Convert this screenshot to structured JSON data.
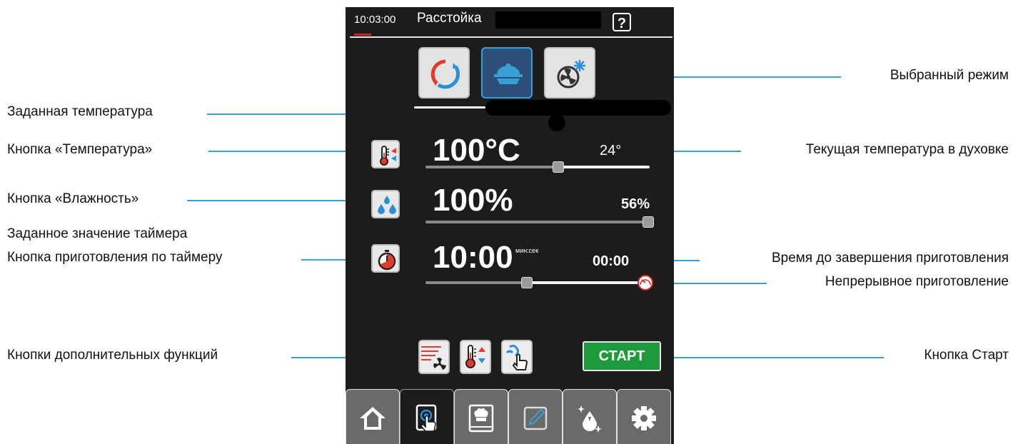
{
  "header": {
    "time": "10:03:00",
    "title": "Расстойка",
    "help_label": "?"
  },
  "modes": [
    {
      "name": "combi-steam",
      "icon": "circular-arrows-icon",
      "selected": false
    },
    {
      "name": "proofing",
      "icon": "covered-dish-icon",
      "selected": true
    },
    {
      "name": "fan-cooling",
      "icon": "fan-snowflake-icon",
      "selected": false
    }
  ],
  "settings": {
    "temperature": {
      "set_value": "100°C",
      "current": "24°",
      "slider_fraction": 0.6
    },
    "humidity": {
      "set_value": "100%",
      "current": "56%",
      "slider_fraction": 1.0
    },
    "timer": {
      "set_value": "10:00",
      "unit": "мин:сек",
      "remaining": "00:00",
      "slider_fraction": 0.45
    }
  },
  "bottom_actions": {
    "start_label": "СТАРТ"
  },
  "tabs": [
    {
      "icon": "home-icon",
      "active": false
    },
    {
      "icon": "touch-screen-icon",
      "active": true
    },
    {
      "icon": "cookbook-icon",
      "active": false
    },
    {
      "icon": "edit-icon",
      "active": false
    },
    {
      "icon": "cleaning-drops-icon",
      "active": false
    },
    {
      "icon": "gear-icon",
      "active": false
    }
  ],
  "callouts": {
    "selected_mode": "Выбранный режим",
    "set_temperature": "Заданная температура",
    "temperature_button": "Кнопка «Температура»",
    "current_oven_temperature": "Текущая температура в духовке",
    "humidity_button": "Кнопка «Влажность»",
    "set_timer_value": "Заданное значение таймера",
    "timer_cooking_button": "Кнопка приготовления по таймеру",
    "time_until_done": "Время до завершения приготовления",
    "continuous_cooking": "Непрерывное приготовление",
    "extra_functions_buttons": "Кнопки дополнительных функций",
    "start_button": "Кнопка Старт"
  },
  "colors": {
    "accent": "#3a9fd4",
    "start_green": "#1e9a3c",
    "panel_bg": "#1c1c1c",
    "red": "#d62828",
    "blue": "#2a8fd6"
  }
}
